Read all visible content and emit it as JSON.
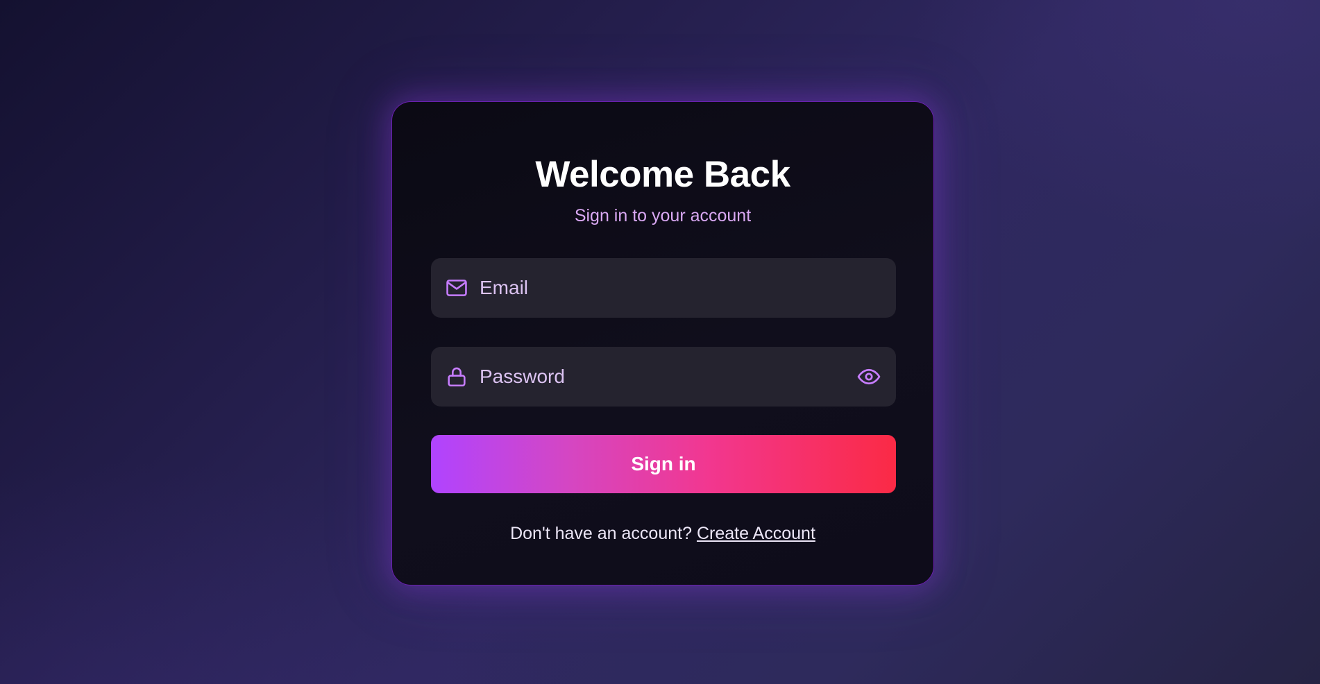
{
  "login": {
    "title": "Welcome Back",
    "subtitle": "Sign in to your account",
    "email_placeholder": "Email",
    "email_value": "",
    "password_placeholder": "Password",
    "password_value": "",
    "signin_label": "Sign in",
    "footer_prompt": "Don't have an account?",
    "create_account_label": "Create Account"
  },
  "icons": {
    "email": "mail-icon",
    "password": "lock-icon",
    "toggle": "eye-icon"
  },
  "colors": {
    "accent": "#b44cf5",
    "gradient_start": "#b044ff",
    "gradient_end": "#fb2a45",
    "card_border": "#6a1fb0",
    "subtitle": "#d9a8f3"
  }
}
